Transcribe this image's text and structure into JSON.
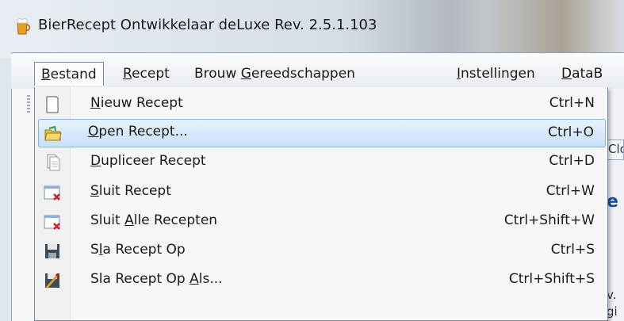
{
  "window": {
    "title": "BierRecept Ontwikkelaar deLuxe Rev. 2.5.1.103"
  },
  "menubar": {
    "items": [
      {
        "pre": "",
        "u": "B",
        "post": "estand"
      },
      {
        "pre": "",
        "u": "R",
        "post": "ecept"
      },
      {
        "pre": "Brouw ",
        "u": "G",
        "post": "ereedschappen"
      },
      {
        "pre": "",
        "u": "I",
        "post": "nstellingen"
      },
      {
        "pre": "",
        "u": "D",
        "post": "ataB"
      }
    ]
  },
  "file_menu": {
    "items": [
      {
        "pre": "",
        "u": "N",
        "post": "ieuw Recept",
        "shortcut": "Ctrl+N",
        "icon": "new-document-icon"
      },
      {
        "pre": "",
        "u": "O",
        "post": "pen Recept...",
        "shortcut": "Ctrl+O",
        "icon": "open-folder-icon"
      },
      {
        "pre": "",
        "u": "D",
        "post": "upliceer Recept",
        "shortcut": "Ctrl+D",
        "icon": "duplicate-icon"
      },
      {
        "pre": "",
        "u": "S",
        "post": "luit Recept",
        "shortcut": "Ctrl+W",
        "icon": "close-recipe-icon"
      },
      {
        "pre": "Sluit ",
        "u": "A",
        "post": "lle Recepten",
        "shortcut": "Ctrl+Shift+W",
        "icon": "close-all-icon"
      },
      {
        "pre": "S",
        "u": "l",
        "post": "a Recept Op",
        "shortcut": "Ctrl+S",
        "icon": "save-icon"
      },
      {
        "pre": "Sla Recept Op ",
        "u": "A",
        "post": "ls...",
        "shortcut": "Ctrl+Shift+S",
        "icon": "save-as-icon"
      }
    ]
  },
  "background": {
    "tab_fragment": "Clo",
    "heading_fragment": "e",
    "text_fragment_1": "v.",
    "text_fragment_2": "gi"
  },
  "colors": {
    "highlight_border": "#80b1e8",
    "highlight_fill": "#c8e0fa",
    "heading_blue": "#1a4fa8"
  }
}
